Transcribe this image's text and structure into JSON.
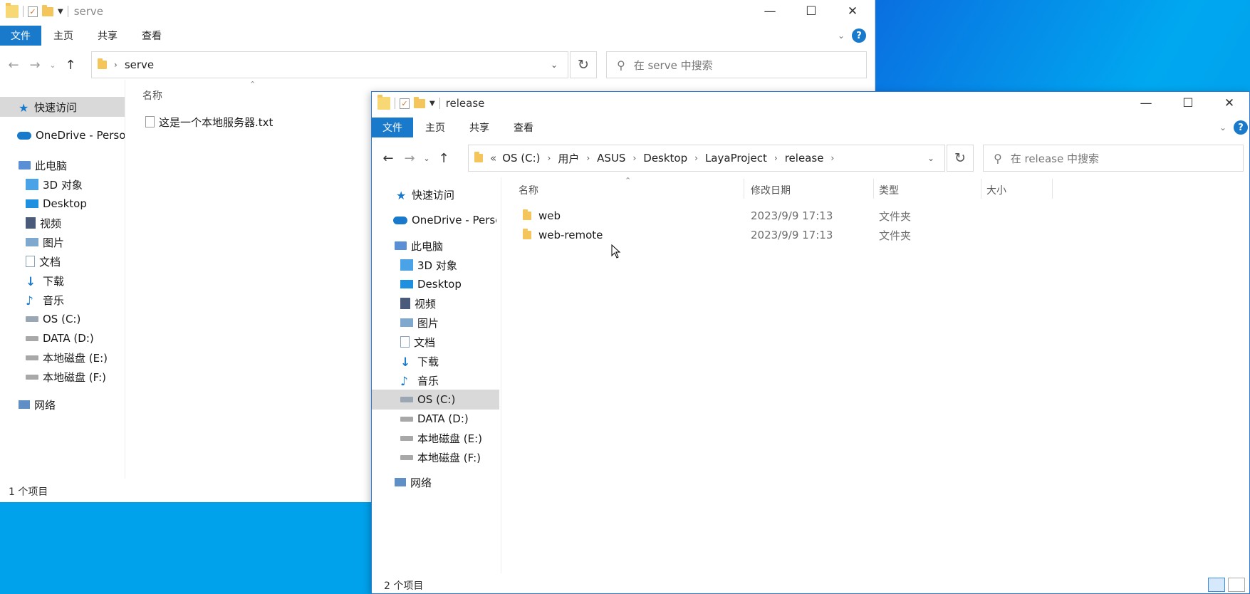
{
  "colors": {
    "accent": "#1979ca",
    "desktop": "#0a5fd0",
    "folder": "#f4c55b",
    "selected": "#d9d9d9"
  },
  "serve": {
    "title": "serve",
    "tabs": {
      "file": "文件",
      "home": "主页",
      "share": "共享",
      "view": "查看"
    },
    "address": {
      "folder": "serve"
    },
    "search_placeholder": "在 serve 中搜索",
    "columns": {
      "name": "名称"
    },
    "nav": {
      "quick": "快速访问",
      "onedrive": "OneDrive - Personal",
      "pc": "此电脑",
      "objects3d": "3D 对象",
      "desktop": "Desktop",
      "videos": "视频",
      "pictures": "图片",
      "documents": "文档",
      "downloads": "下载",
      "music": "音乐",
      "os": "OS (C:)",
      "data": "DATA (D:)",
      "diskE": "本地磁盘 (E:)",
      "diskF": "本地磁盘 (F:)",
      "network": "网络"
    },
    "files": [
      {
        "name": "这是一个本地服务器.txt",
        "icon": "text-file-icon"
      }
    ],
    "status": "1 个项目"
  },
  "release": {
    "title": "release",
    "tabs": {
      "file": "文件",
      "home": "主页",
      "share": "共享",
      "view": "查看"
    },
    "breadcrumb": {
      "more": "«",
      "c0": "OS (C:)",
      "c1": "用户",
      "c2": "ASUS",
      "c3": "Desktop",
      "c4": "LayaProject",
      "c5": "release"
    },
    "search_placeholder": "在 release 中搜索",
    "columns": {
      "name": "名称",
      "date": "修改日期",
      "type": "类型",
      "size": "大小"
    },
    "nav": {
      "quick": "快速访问",
      "onedrive": "OneDrive - Personal",
      "pc": "此电脑",
      "objects3d": "3D 对象",
      "desktop": "Desktop",
      "videos": "视频",
      "pictures": "图片",
      "documents": "文档",
      "downloads": "下载",
      "music": "音乐",
      "os": "OS (C:)",
      "data": "DATA (D:)",
      "diskE": "本地磁盘 (E:)",
      "diskF": "本地磁盘 (F:)",
      "network": "网络"
    },
    "rows": [
      {
        "name": "web",
        "date": "2023/9/9 17:13",
        "type": "文件夹",
        "size": ""
      },
      {
        "name": "web-remote",
        "date": "2023/9/9 17:13",
        "type": "文件夹",
        "size": ""
      }
    ],
    "status": "2 个项目"
  }
}
